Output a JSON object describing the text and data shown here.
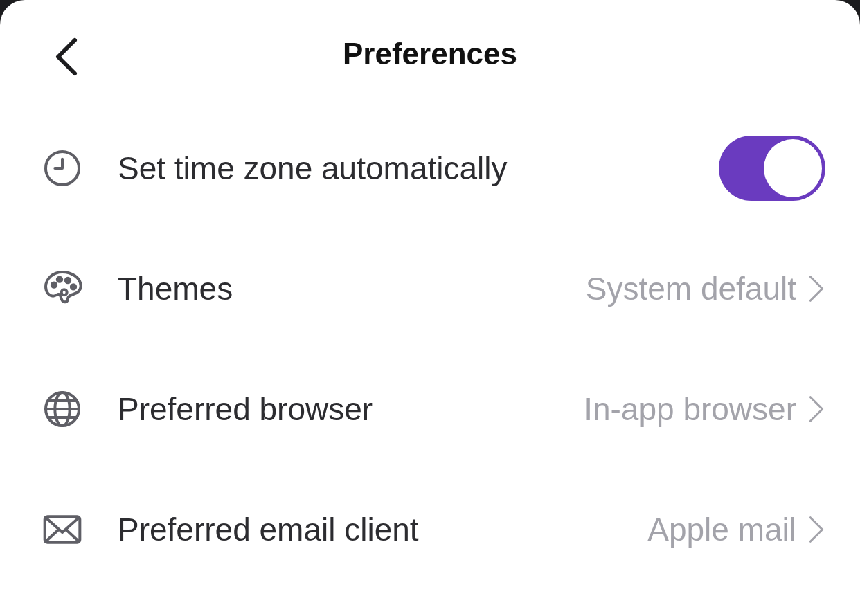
{
  "header": {
    "title": "Preferences"
  },
  "rows": [
    {
      "kind": "toggle",
      "label": "Set time zone automatically",
      "on": true
    },
    {
      "kind": "link",
      "label": "Themes",
      "value": "System default"
    },
    {
      "kind": "link",
      "label": "Preferred browser",
      "value": "In-app browser"
    },
    {
      "kind": "link",
      "label": "Preferred email client",
      "value": "Apple mail"
    }
  ]
}
